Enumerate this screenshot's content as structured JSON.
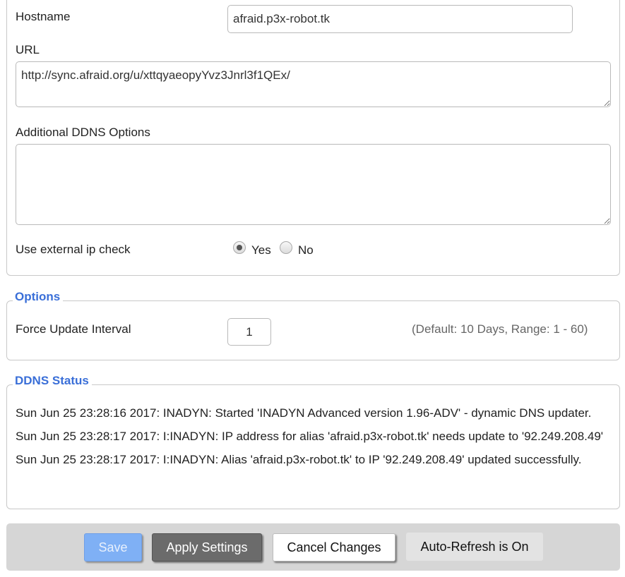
{
  "ddns": {
    "hostname_label": "Hostname",
    "hostname_value": "afraid.p3x-robot.tk",
    "url_label": "URL",
    "url_value": "http://sync.afraid.org/u/xttqyaeopyYvz3Jnrl3f1QEx/",
    "additional_label": "Additional DDNS Options",
    "additional_value": "",
    "external_ip_label": "Use external ip check",
    "external_ip_yes": "Yes",
    "external_ip_no": "No",
    "external_ip_selected": "Yes"
  },
  "options": {
    "legend": "Options",
    "force_update_label": "Force Update Interval",
    "force_update_value": "1",
    "force_update_hint": "(Default: 10 Days, Range: 1 - 60)"
  },
  "status": {
    "legend": "DDNS Status",
    "lines": [
      "Sun Jun 25 23:28:16 2017: INADYN: Started 'INADYN Advanced version 1.96-ADV' - dynamic DNS updater.",
      "Sun Jun 25 23:28:17 2017: I:INADYN: IP address for alias 'afraid.p3x-robot.tk' needs update to '92.249.208.49'",
      "Sun Jun 25 23:28:17 2017: I:INADYN: Alias 'afraid.p3x-robot.tk' to IP '92.249.208.49' updated successfully."
    ]
  },
  "footer": {
    "save_label": "Save",
    "apply_label": "Apply Settings",
    "cancel_label": "Cancel Changes",
    "refresh_label": "Auto-Refresh is On"
  },
  "colors": {
    "legend": "#3a6fd8",
    "save_button": "#7fb0f5",
    "apply_button": "#6b6b6b",
    "footer_bar": "#d6d6d6"
  }
}
